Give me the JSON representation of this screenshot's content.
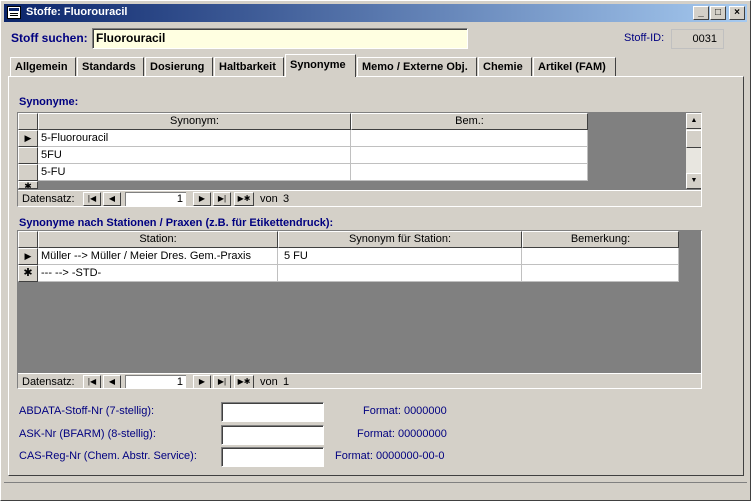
{
  "window": {
    "title": "Stoffe: Fluorouracil",
    "buttons": {
      "minimize": "_",
      "maximize": "□",
      "close": "×"
    }
  },
  "search": {
    "label": "Stoff suchen:",
    "value": "Fluorouracil"
  },
  "stoff_id": {
    "label": "Stoff-ID:",
    "value": "0031"
  },
  "tabs": [
    {
      "label": "Allgemein"
    },
    {
      "label": "Standards"
    },
    {
      "label": "Dosierung"
    },
    {
      "label": "Haltbarkeit"
    },
    {
      "label": "Synonyme"
    },
    {
      "label": "Memo / Externe Obj."
    },
    {
      "label": "Chemie"
    },
    {
      "label": "Artikel (FAM)"
    }
  ],
  "active_tab": "Synonyme",
  "synonyms": {
    "title": "Synonyme:",
    "columns": [
      "Synonym:",
      "Bem.:"
    ],
    "rows": [
      {
        "synonym": "5-Fluorouracil",
        "bem": ""
      },
      {
        "synonym": "5FU",
        "bem": ""
      },
      {
        "synonym": "5-FU",
        "bem": ""
      }
    ],
    "nav": {
      "label": "Datensatz:",
      "record": "1",
      "of_label": "von",
      "total": "3"
    }
  },
  "stations": {
    "title": "Synonyme nach Stationen / Praxen (z.B. für Etikettendruck):",
    "columns": [
      "Station:",
      "Synonym für Station:",
      "Bemerkung:"
    ],
    "rows": [
      {
        "station": "Müller --> Müller / Meier Dres. Gem.-Praxis",
        "synonym": "5 FU",
        "bemerkung": ""
      },
      {
        "station": "--- --> -STD-",
        "synonym": "",
        "bemerkung": ""
      }
    ],
    "nav": {
      "label": "Datensatz:",
      "record": "1",
      "of_label": "von",
      "total": "1"
    }
  },
  "codes": [
    {
      "label": "ABDATA-Stoff-Nr (7-stellig):",
      "value": "",
      "format": "Format: 0000000"
    },
    {
      "label": "ASK-Nr (BFARM) (8-stellig):",
      "value": "",
      "format": "Format: 00000000"
    },
    {
      "label": "CAS-Reg-Nr (Chem. Abstr. Service):",
      "value": "",
      "format": "Format: 0000000-00-0"
    }
  ],
  "icons": {
    "record_current": "▶",
    "record_new": "✱",
    "nav_first": "|◀",
    "nav_prev": "◀",
    "nav_next": "▶",
    "nav_last": "▶|",
    "nav_new": "▶✱",
    "scroll_up": "▲",
    "scroll_down": "▼"
  },
  "colors": {
    "title_start": "#0a246a",
    "title_end": "#a6caf0",
    "label_blue": "#000080",
    "search_bg": "#ffffe1"
  }
}
